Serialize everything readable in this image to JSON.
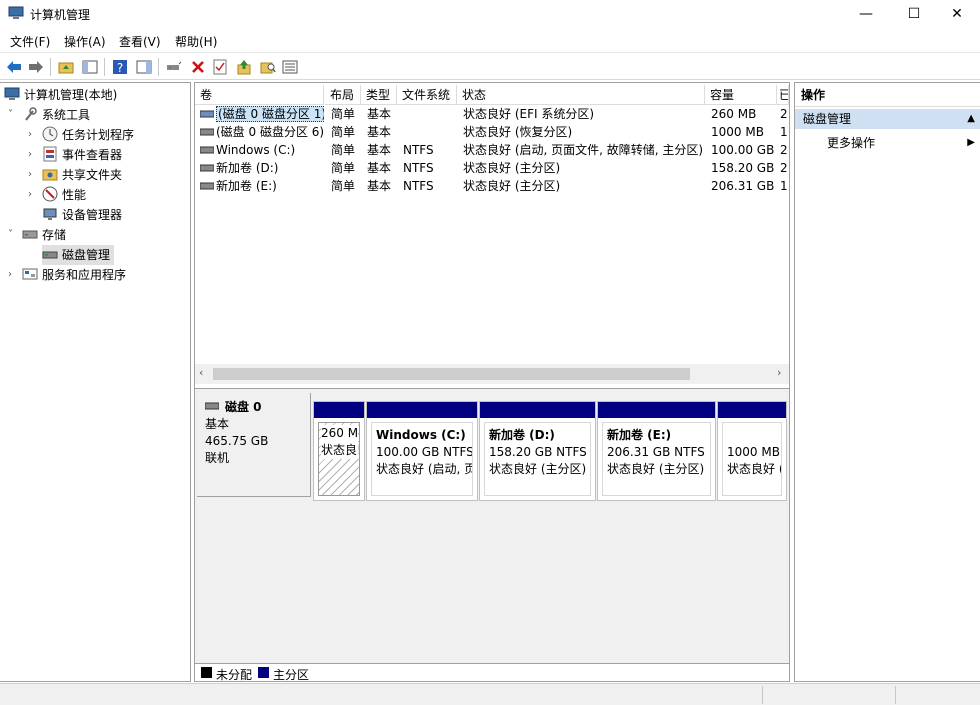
{
  "window": {
    "title": "计算机管理",
    "controls": {
      "minimize": "—",
      "maximize": "☐",
      "close": "✕"
    }
  },
  "menu": [
    "文件(F)",
    "操作(A)",
    "查看(V)",
    "帮助(H)"
  ],
  "tree": {
    "root": "计算机管理(本地)",
    "system_tools": "系统工具",
    "task_scheduler": "任务计划程序",
    "event_viewer": "事件查看器",
    "shared_folders": "共享文件夹",
    "performance": "性能",
    "device_manager": "设备管理器",
    "storage": "存储",
    "disk_management": "磁盘管理",
    "services_apps": "服务和应用程序"
  },
  "table": {
    "columns": [
      "卷",
      "布局",
      "类型",
      "文件系统",
      "状态",
      "容量",
      "已"
    ],
    "rows": [
      {
        "volume": "(磁盘 0 磁盘分区 1)",
        "layout": "简单",
        "type": "基本",
        "fs": "",
        "status": "状态良好 (EFI 系统分区)",
        "capacity": "260 MB",
        "free": "2"
      },
      {
        "volume": "(磁盘 0 磁盘分区 6)",
        "layout": "简单",
        "type": "基本",
        "fs": "",
        "status": "状态良好 (恢复分区)",
        "capacity": "1000 MB",
        "free": "1"
      },
      {
        "volume": "Windows (C:)",
        "layout": "简单",
        "type": "基本",
        "fs": "NTFS",
        "status": "状态良好 (启动, 页面文件, 故障转储, 主分区)",
        "capacity": "100.00 GB",
        "free": "2"
      },
      {
        "volume": "新加卷 (D:)",
        "layout": "简单",
        "type": "基本",
        "fs": "NTFS",
        "status": "状态良好 (主分区)",
        "capacity": "158.20 GB",
        "free": "2"
      },
      {
        "volume": "新加卷 (E:)",
        "layout": "简单",
        "type": "基本",
        "fs": "NTFS",
        "status": "状态良好 (主分区)",
        "capacity": "206.31 GB",
        "free": "1"
      }
    ]
  },
  "disk": {
    "name": "磁盘 0",
    "type": "基本",
    "size": "465.75 GB",
    "state": "联机",
    "partitions": [
      {
        "title": "",
        "size": "260 M",
        "status": "状态良!"
      },
      {
        "title": "Windows  (C:)",
        "size": "100.00 GB NTFS",
        "status": "状态良好 (启动, 页"
      },
      {
        "title": "新加卷  (D:)",
        "size": "158.20 GB NTFS",
        "status": "状态良好 (主分区)"
      },
      {
        "title": "新加卷  (E:)",
        "size": "206.31 GB NTFS",
        "status": "状态良好 (主分区)"
      },
      {
        "title": "",
        "size": "1000 MB",
        "status": "状态良好 ("
      }
    ]
  },
  "legend": {
    "unallocated": "未分配",
    "primary": "主分区",
    "unallocated_color": "#000000",
    "primary_color": "#000080"
  },
  "actions": {
    "header": "操作",
    "section": "磁盘管理",
    "more": "更多操作"
  }
}
